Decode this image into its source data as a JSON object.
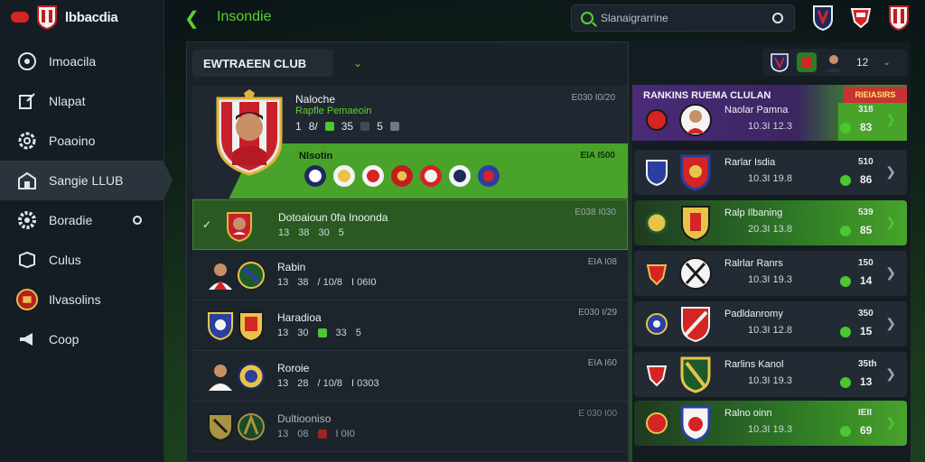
{
  "app": {
    "brand_name": "lbbacdia",
    "brand_color": "#d52424",
    "accent_color": "#5bd12f"
  },
  "sidebar": {
    "items": [
      {
        "label": "Imoacila",
        "icon": "target-icon"
      },
      {
        "label": "Nlapat",
        "icon": "edit-icon"
      },
      {
        "label": "Poaoino",
        "icon": "gear-icon"
      },
      {
        "label": "Sangie LLUB",
        "icon": "stadium-icon",
        "active": true
      },
      {
        "label": "Boradie",
        "icon": "settings-icon"
      },
      {
        "label": "Culus",
        "icon": "box-icon"
      },
      {
        "label": "Ilvasolins",
        "icon": "crest-icon"
      },
      {
        "label": "Coop",
        "icon": "megaphone-icon"
      }
    ]
  },
  "topbar": {
    "title": "Insondie",
    "search_text": "Slanaigrarrine"
  },
  "main": {
    "club_select": "EWTRAEEN CLUB",
    "hero": {
      "name": "Naloche",
      "subtitle": "Rapfle Pemaeoin",
      "stats": [
        "1",
        "8/",
        "35",
        "5"
      ],
      "right_top": "E030 I0/20",
      "team_label": "Nlsotin",
      "right_bottom": "EIA I500"
    },
    "rows": [
      {
        "name": "Dotoaioun 0fa Inoonda",
        "stats": [
          "13",
          "38",
          "30",
          "5"
        ],
        "right": "E038 I030",
        "selected": true
      },
      {
        "name": "Rabin",
        "stats": [
          "13",
          "38",
          "/ 10/8",
          "I 06I0"
        ],
        "right": "EIA I08"
      },
      {
        "name": "Haradioa",
        "stats": [
          "13",
          "30",
          "33",
          "5"
        ],
        "right": "E030 I/29"
      },
      {
        "name": "Roroie",
        "stats": [
          "13",
          "28",
          "/ 10/8",
          "I 0303"
        ],
        "right": "EIA I60"
      },
      {
        "name": "Dultiooniso",
        "stats": [
          "13",
          "08",
          "",
          "I 0I0"
        ],
        "right": "E 030 I00"
      }
    ]
  },
  "right_panel": {
    "head_count": "12",
    "ranking_title": "RANKINS RUEMA CLULAN",
    "ranking_tag": "RIEIASIRS",
    "ranks": [
      {
        "name": "Naolar Pamna",
        "stats": "10.3I  12.3",
        "top": "318",
        "score": "83",
        "green": true
      },
      {
        "name": "Rarlar Isdia",
        "stats": "10.3I  19.8",
        "top": "510",
        "score": "86",
        "green": false
      },
      {
        "name": "Ralp Ilbaning",
        "stats": "20.3I  13.8",
        "top": "539",
        "score": "85",
        "green": true
      },
      {
        "name": "Ralrlar Ranrs",
        "stats": "10.3I  19.3",
        "top": "150",
        "score": "14",
        "green": false
      },
      {
        "name": "Padldanromy",
        "stats": "10.3I  12.8",
        "top": "350",
        "score": "15",
        "green": false
      },
      {
        "name": "Rarlins Kanol",
        "stats": "10.3I  19.3",
        "top": "35th",
        "score": "13",
        "green": false
      },
      {
        "name": "Ralno oinn",
        "stats": "10.3I  19.3",
        "top": "IEII",
        "score": "69",
        "green": true
      }
    ]
  }
}
